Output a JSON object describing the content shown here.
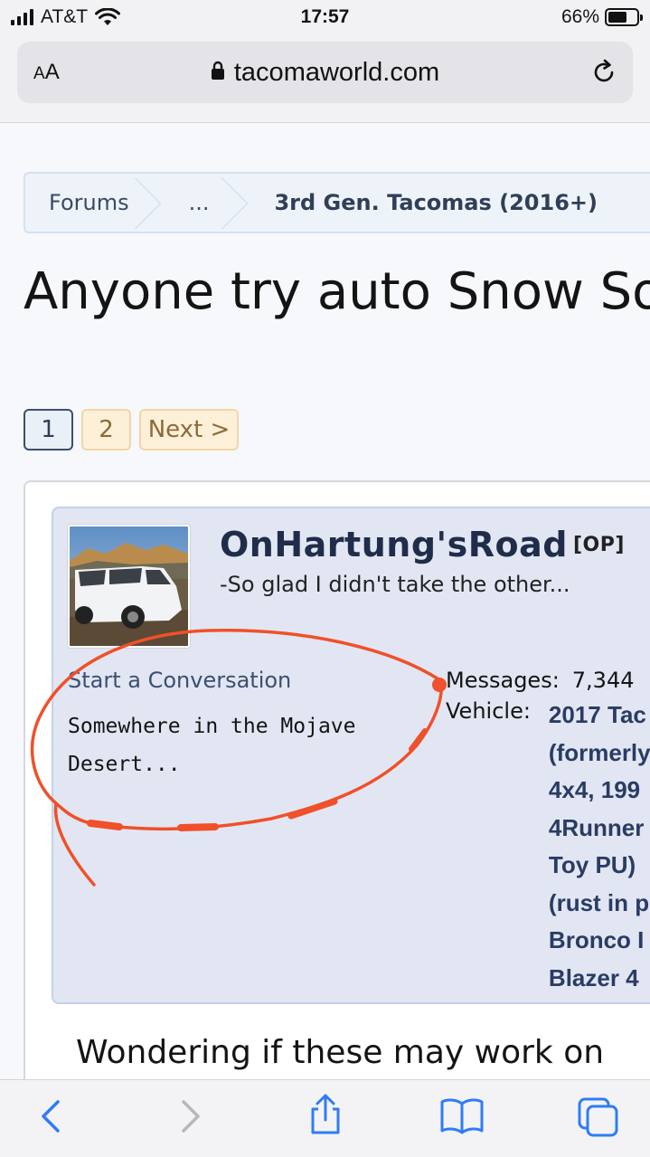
{
  "status_bar": {
    "carrier": "AT&T",
    "time": "17:57",
    "battery": "66%",
    "battery_level": 0.66
  },
  "browser": {
    "text_size_label": "AA",
    "url": "tacomaworld.com"
  },
  "breadcrumb": [
    "Forums",
    "...",
    "3rd Gen. Tacomas (2016+)"
  ],
  "thread": {
    "title": "Anyone try auto Snow So"
  },
  "pagination": {
    "current": "1",
    "page2": "2",
    "next": "Next >"
  },
  "post": {
    "username": "OnHartung'sRoad",
    "op_badge": "[OP]",
    "user_title": "-So glad I didn't take the other...",
    "start_conversation": "Start a Conversation",
    "location_line1": "Somewhere in the Mojave",
    "location_line2": "Desert...",
    "messages_label": "Messages:",
    "messages_value": "7,344",
    "vehicle_label": "Vehicle:",
    "vehicle_lines": [
      "2017 Tac",
      "(formerly",
      "4x4, 199",
      "4Runner",
      "Toy PU)",
      "(rust in p",
      "Bronco I",
      "Blazer 4"
    ],
    "body": "Wondering if these may work on"
  },
  "icons": {
    "back": "chevron-left-icon",
    "forward": "chevron-right-icon",
    "share": "share-icon",
    "bookmarks": "book-icon",
    "tabs": "tabs-icon"
  },
  "colors": {
    "link_blue": "#2a3c64",
    "ios_blue": "#2f7cf6",
    "annotation": "#f0502a"
  }
}
